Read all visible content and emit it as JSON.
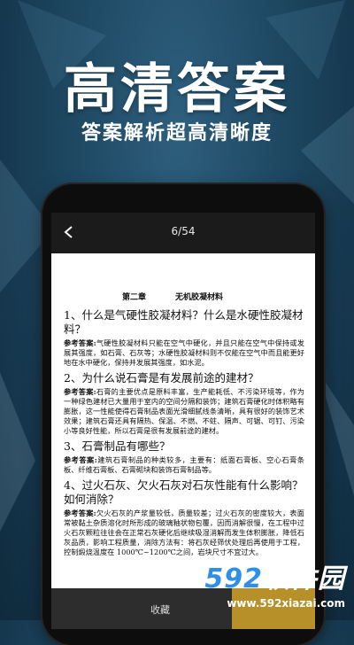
{
  "hero": {
    "title": "高清答案",
    "subtitle": "答案解析超高清晰度"
  },
  "topbar": {
    "page_counter": "6/54",
    "back_icon": "chevron-left-icon"
  },
  "document": {
    "chapter_number": "第二章",
    "chapter_title": "无机胶凝材料",
    "items": [
      {
        "question": "1、什么是气硬性胶凝材料？什么是水硬性胶凝材料？",
        "answer_label": "参考答案:",
        "answer": "气硬性胶凝材料只能在空气中硬化，并且只能在空气中保持或发展其强度，如石膏、石灰等；水硬性胶凝材料则不仅能在空气中而且能更好地在水中硬化，保持并发展其强度，如水泥。"
      },
      {
        "question": "2、为什么说石膏是有发展前途的建材？",
        "answer_label": "参考答案:",
        "answer": "石膏的主要优点是原料丰富，生产能耗低、不污染环境等，作为一种绿色建材已大量用于室内的空间分隔和装饰；建筑石膏硬化时体积略有膨胀，这一性能使得石膏制品表面光滑细腻线条清晰，具有很好的装饰艺术效果；建筑石膏还具有隔热、保温、不燃、不蛀、隔声、可锯、可钉、污染小等良好性能，所以石膏是很有发展前途的建材。"
      },
      {
        "question": "3、石膏制品有哪些？",
        "answer_label": "参考答案:",
        "answer": "建筑石膏制品的种类较多，主要有：纸面石膏板、空心石膏条板、纤维石膏板、石膏砌块和装饰石膏制品等。"
      },
      {
        "question": "4、过火石灰、欠火石灰对石灰性能有什么影响？如何消除？",
        "answer_label": "参考答案:",
        "answer": "欠火石灰的产浆量较低，质量较差；过火石灰的密度较大，表面常被黏土杂质溶化时所形成的玻璃釉状物包覆，因而消解很慢，在工程中过火石灰颗粒往往会在正常石灰硬化后继续吸湿消解而发生体积膨胀，降低石灰品质，影响工程质量，消除方法有：将石灰经筛伏处理后再使用于工程，控制煅烧温度在 1000℃~1200℃之间，岩块尺寸不宜过大。"
      }
    ]
  },
  "bottombar": {
    "favorite_label": "收藏"
  },
  "watermark": {
    "brand_digits": "592",
    "brand_text": "软件园",
    "url": "www.592xiazai.com"
  },
  "colors": {
    "background": "#1d4660",
    "accent_gold": "#b8902a",
    "brand_blue": "#2f8fe6"
  }
}
